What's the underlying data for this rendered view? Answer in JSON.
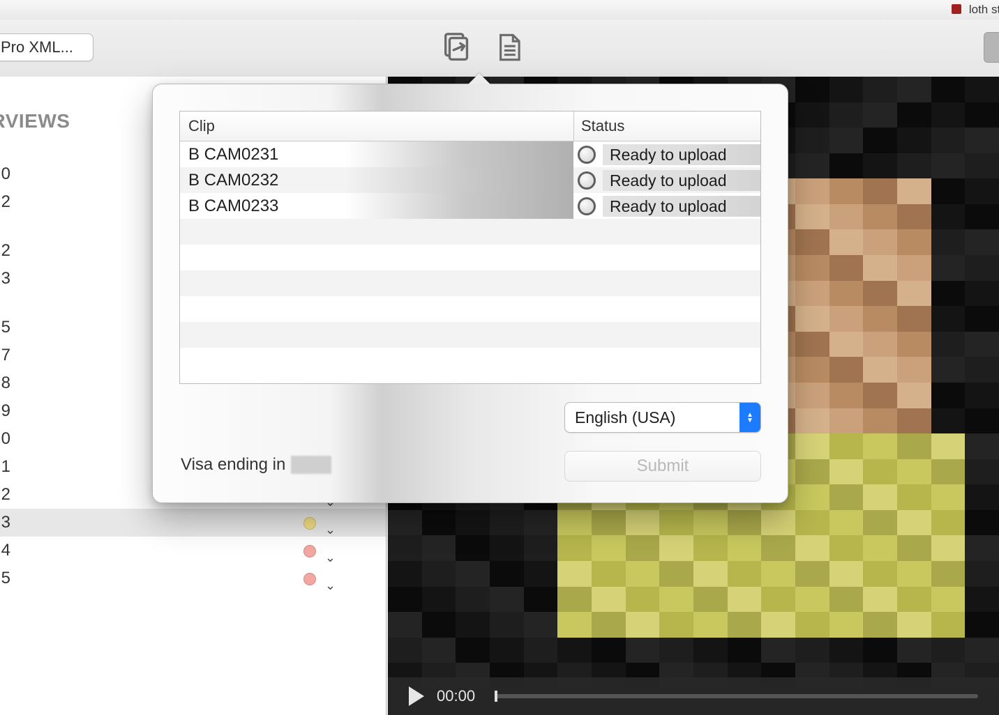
{
  "window": {
    "title_fragment": "loth street i"
  },
  "toolbar": {
    "pro_xml_label": "Pro XML...",
    "export_icon": "export-stack-icon",
    "document_icon": "document-icon"
  },
  "sidebar": {
    "section_label": "NTERVIEWS",
    "rows_group_a": [
      {
        "digit": "0"
      },
      {
        "digit": "2"
      }
    ],
    "rows_group_b": [
      {
        "digit": "2"
      },
      {
        "digit": "3"
      }
    ],
    "rows_group_c": [
      {
        "digit": "5",
        "dot": "green"
      },
      {
        "digit": "7",
        "dot": "yellow"
      },
      {
        "digit": "8",
        "dot": "yellow"
      },
      {
        "digit": "9",
        "dot": "yellow"
      },
      {
        "digit": "0",
        "dot": "yellow"
      },
      {
        "digit": "1",
        "dot": "yellow"
      },
      {
        "digit": "2",
        "dot": "yellow"
      },
      {
        "digit": "3",
        "dot": "yellow",
        "selected": true
      },
      {
        "digit": "4",
        "dot": "red"
      },
      {
        "digit": "5",
        "dot": "red"
      }
    ]
  },
  "popover": {
    "columns": {
      "clip": "Clip",
      "status": "Status"
    },
    "rows": [
      {
        "clip": "B CAM0231",
        "status": "Ready to upload"
      },
      {
        "clip": "B CAM0232",
        "status": "Ready to upload"
      },
      {
        "clip": "B CAM0233",
        "status": "Ready to upload"
      }
    ],
    "language_label": "English (USA)",
    "payment_prefix": "Visa ending in",
    "submit_label": "Submit"
  },
  "video": {
    "timecode": "00:00"
  }
}
